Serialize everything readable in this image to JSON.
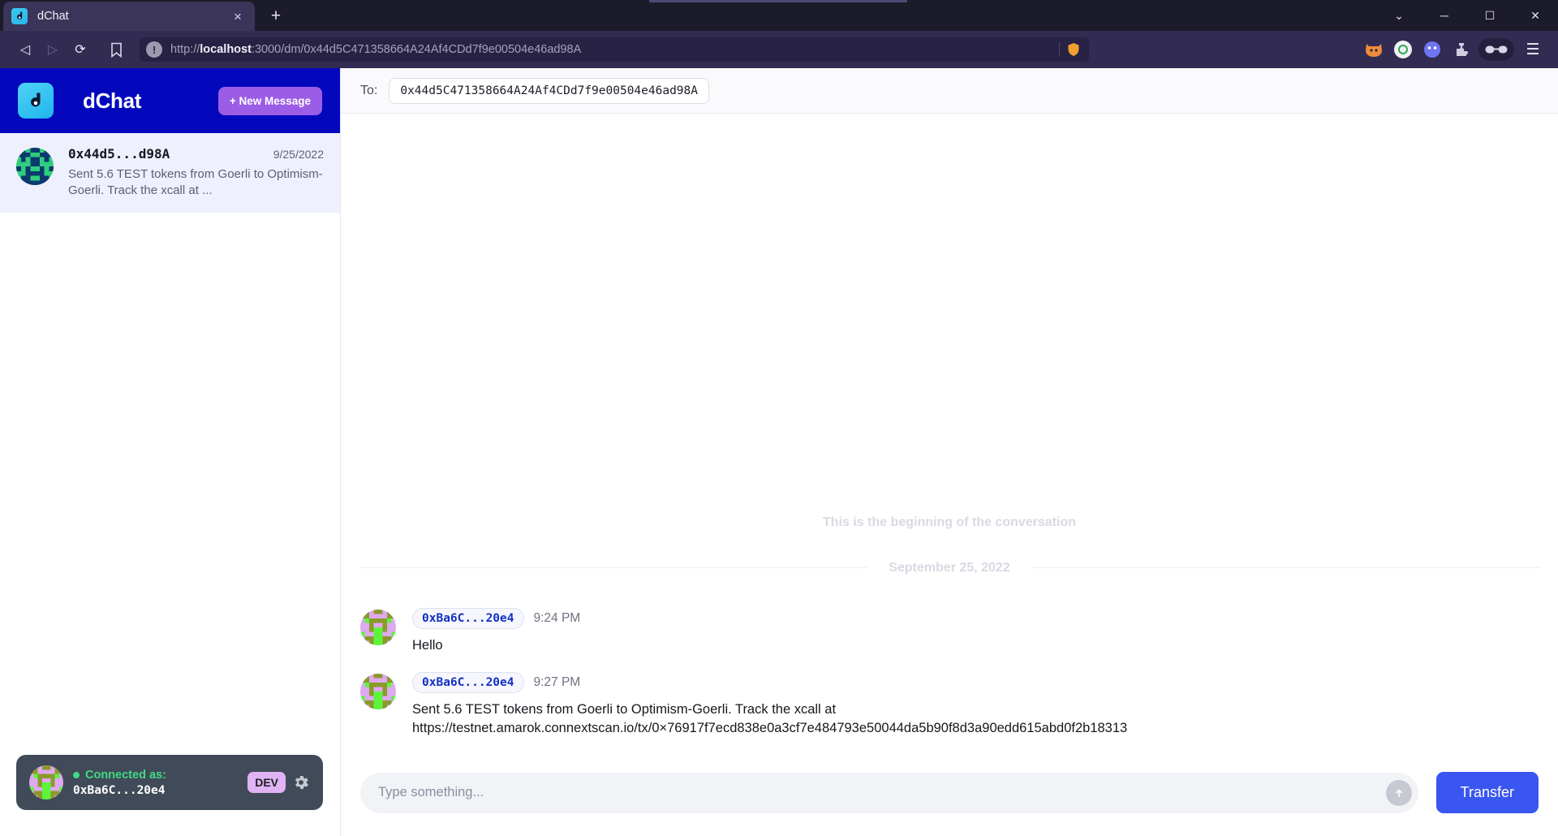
{
  "browser": {
    "tab": {
      "title": "dChat",
      "favicon": "dchat-logo-icon",
      "close_label": "×"
    },
    "new_tab_label": "+",
    "window_controls": {
      "minimize_to_tray": "⌄",
      "minimize": "─",
      "maximize": "☐",
      "close": "✕"
    },
    "nav": {
      "back": "◁",
      "forward": "▷",
      "reload": "⟳",
      "bookmark": "☐"
    },
    "url": {
      "scheme": "http://",
      "host": "localhost",
      "rest": ":3000/dm/0x44d5C471358664A24Af4CDd7f9e00504e46ad98A",
      "full": "http://localhost:3000/dm/0x44d5C471358664A24Af4CDd7f9e00504e46ad98A",
      "info_glyph": "!"
    },
    "menu_glyph": "☰"
  },
  "sidebar": {
    "app_title": "dChat",
    "new_message_button": "+ New Message",
    "conversations": [
      {
        "name": "0x44d5...d98A",
        "date": "9/25/2022",
        "preview": "Sent 5.6 TEST tokens from Goerli to Optimism-Goerli. Track the xcall at ..."
      }
    ],
    "connection": {
      "status_label": "Connected as:",
      "address": "0xBa6C...20e4",
      "env_badge": "DEV",
      "settings_icon": "gear-icon",
      "status_color": "#3ddc84"
    }
  },
  "main": {
    "to_label": "To:",
    "to_address": "0x44d5C471358664A24Af4CDd7f9e00504e46ad98A",
    "beginning_text": "This is the beginning of the conversation",
    "date_divider": "September 25, 2022",
    "messages": [
      {
        "sender": "0xBa6C...20e4",
        "time": "9:24 PM",
        "text": "Hello"
      },
      {
        "sender": "0xBa6C...20e4",
        "time": "9:27 PM",
        "text": "Sent 5.6 TEST tokens from Goerli to Optimism-Goerli. Track the xcall at https://testnet.amarok.connextscan.io/tx/0×76917f7ecd838e0a3cf7e484793e50044da5b90f8d3a90edd615abd0f2b18313"
      }
    ],
    "composer": {
      "placeholder": "Type something...",
      "value": "",
      "send_icon": "send-arrow-icon",
      "transfer_button": "Transfer"
    }
  },
  "colors": {
    "sidebar_header": "#0408bd",
    "accent_purple": "#9b5de5",
    "transfer_blue": "#3a56f0",
    "sender_blue": "#1430c4",
    "connected_green": "#3ddc84"
  }
}
